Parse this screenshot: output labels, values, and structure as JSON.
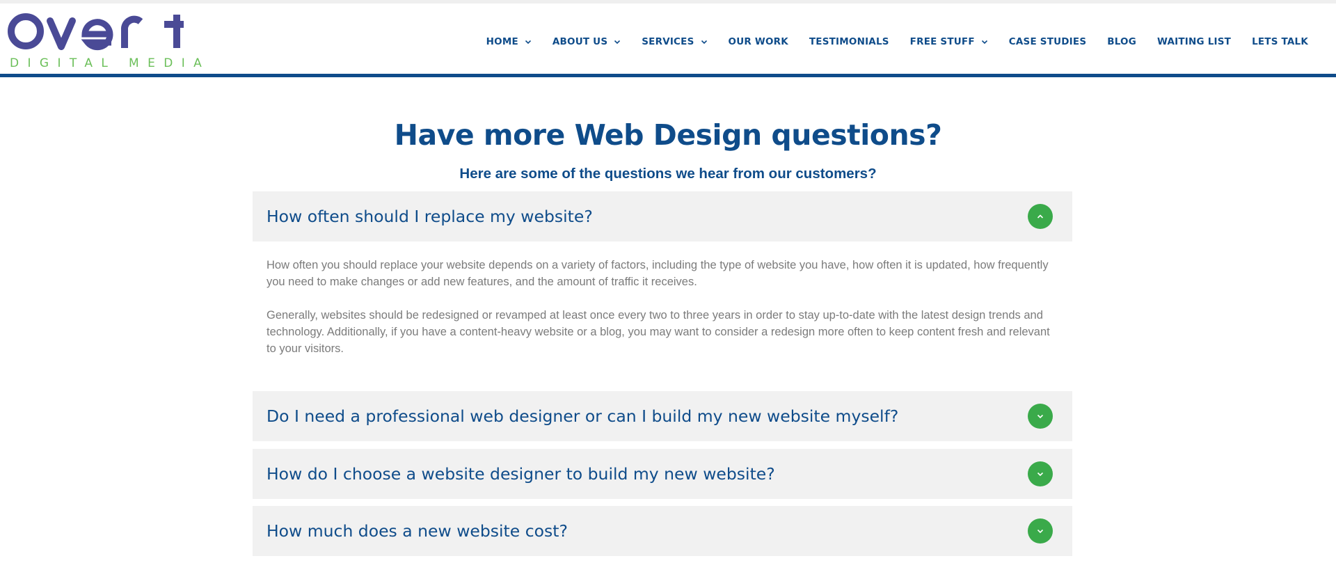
{
  "logo": {
    "wordmark": "Overt",
    "tagline": "DIGITAL MEDIA",
    "colors": {
      "wordmark": "#4a4a96",
      "tagline": "#6bbf59"
    }
  },
  "nav": {
    "items": [
      {
        "label": "HOME",
        "has_dropdown": true
      },
      {
        "label": "ABOUT US",
        "has_dropdown": true
      },
      {
        "label": "SERVICES",
        "has_dropdown": true
      },
      {
        "label": "OUR WORK",
        "has_dropdown": false
      },
      {
        "label": "TESTIMONIALS",
        "has_dropdown": false
      },
      {
        "label": "FREE STUFF",
        "has_dropdown": true
      },
      {
        "label": "CASE STUDIES",
        "has_dropdown": false
      },
      {
        "label": "BLOG",
        "has_dropdown": false
      },
      {
        "label": "WAITING LIST",
        "has_dropdown": false
      },
      {
        "label": "LETS TALK",
        "has_dropdown": false
      }
    ],
    "dropdown_icon": "chevron-down-icon"
  },
  "main": {
    "title": "Have more Web Design questions?",
    "subtitle": "Here are some of the questions we hear from our customers?"
  },
  "faq": {
    "items": [
      {
        "question": "How often should I replace my website?",
        "expanded": true,
        "toggle_icon": "chevron-up-icon",
        "answer": [
          "How often you should replace your website depends on a variety of factors, including the type of website you have, how often it is updated, how frequently you need to make changes or add new features, and the amount of traffic it receives.",
          "Generally, websites should be redesigned or revamped at least once every two to three years in order to stay up-to-date with the latest design trends and technology. Additionally, if you have a content-heavy website or a blog, you may want to consider a redesign more often to keep content fresh and relevant to your visitors."
        ]
      },
      {
        "question": "Do I need a professional web designer or can I build my new website myself?",
        "expanded": false,
        "toggle_icon": "chevron-down-icon"
      },
      {
        "question": "How do I choose a website designer to build my new website?",
        "expanded": false,
        "toggle_icon": "chevron-down-icon"
      },
      {
        "question": "How much does a new website cost?",
        "expanded": false,
        "toggle_icon": "chevron-down-icon"
      }
    ]
  },
  "colors": {
    "brand_blue": "#0f4c8a",
    "accent_green": "#3aaa4a",
    "panel_bg": "#f1f1f1",
    "body_text": "#7b7b7b"
  }
}
